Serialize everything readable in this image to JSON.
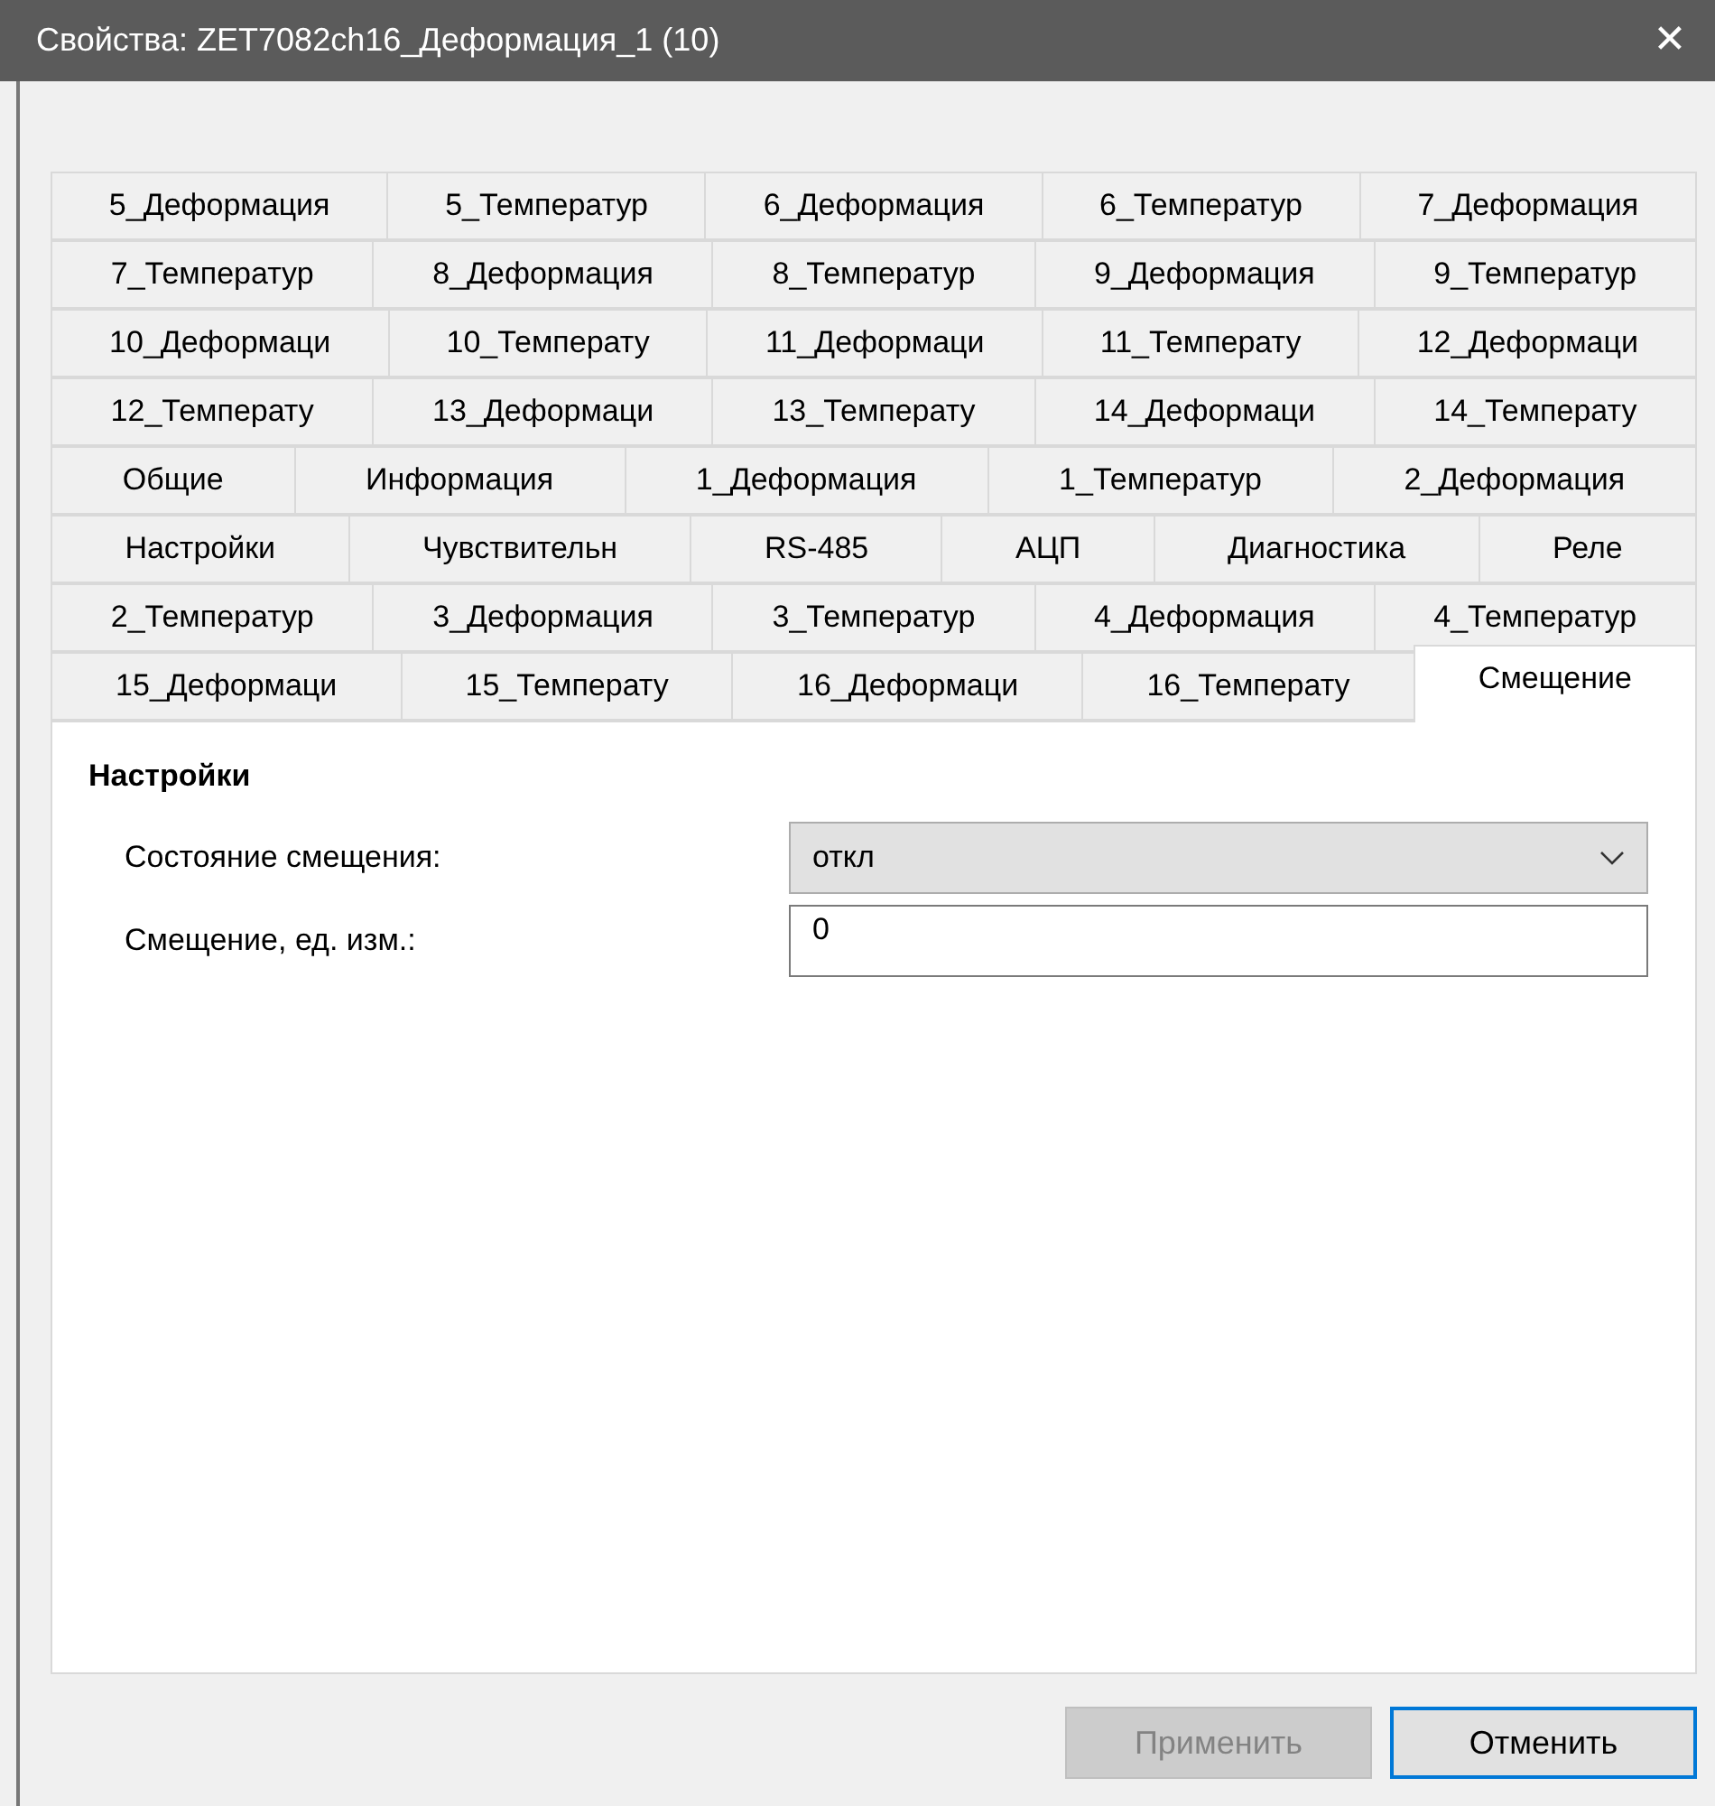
{
  "window": {
    "title": "Свойства: ZET7082ch16_Деформация_1 (10)",
    "close": "✕"
  },
  "tab_rows": [
    [
      {
        "label": "5_Деформация",
        "selected": false
      },
      {
        "label": "5_Температур",
        "selected": false
      },
      {
        "label": "6_Деформация",
        "selected": false
      },
      {
        "label": "6_Температур",
        "selected": false
      },
      {
        "label": "7_Деформация",
        "selected": false
      }
    ],
    [
      {
        "label": "7_Температур",
        "selected": false
      },
      {
        "label": "8_Деформация",
        "selected": false
      },
      {
        "label": "8_Температур",
        "selected": false
      },
      {
        "label": "9_Деформация",
        "selected": false
      },
      {
        "label": "9_Температур",
        "selected": false
      }
    ],
    [
      {
        "label": "10_Деформаци",
        "selected": false
      },
      {
        "label": "10_Температу",
        "selected": false
      },
      {
        "label": "11_Деформаци",
        "selected": false
      },
      {
        "label": "11_Температу",
        "selected": false
      },
      {
        "label": "12_Деформаци",
        "selected": false
      }
    ],
    [
      {
        "label": "12_Температу",
        "selected": false
      },
      {
        "label": "13_Деформаци",
        "selected": false
      },
      {
        "label": "13_Температу",
        "selected": false
      },
      {
        "label": "14_Деформаци",
        "selected": false
      },
      {
        "label": "14_Температу",
        "selected": false
      }
    ],
    [
      {
        "label": "Общие",
        "selected": false
      },
      {
        "label": "Информация",
        "selected": false
      },
      {
        "label": "1_Деформация",
        "selected": false
      },
      {
        "label": "1_Температур",
        "selected": false
      },
      {
        "label": "2_Деформация",
        "selected": false
      }
    ],
    [
      {
        "label": "Настройки",
        "selected": false
      },
      {
        "label": "Чувствительн",
        "selected": false
      },
      {
        "label": "RS-485",
        "selected": false
      },
      {
        "label": "АЦП",
        "selected": false
      },
      {
        "label": "Диагностика",
        "selected": false
      },
      {
        "label": "Реле",
        "selected": false
      }
    ],
    [
      {
        "label": "2_Температур",
        "selected": false
      },
      {
        "label": "3_Деформация",
        "selected": false
      },
      {
        "label": "3_Температур",
        "selected": false
      },
      {
        "label": "4_Деформация",
        "selected": false
      },
      {
        "label": "4_Температур",
        "selected": false
      }
    ],
    [
      {
        "label": "15_Деформаци",
        "selected": false
      },
      {
        "label": "15_Температу",
        "selected": false
      },
      {
        "label": "16_Деформаци",
        "selected": false
      },
      {
        "label": "16_Температу",
        "selected": false
      },
      {
        "label": "Смещение",
        "selected": true
      }
    ]
  ],
  "section": {
    "title": "Настройки"
  },
  "fields": [
    {
      "kind": "dropdown",
      "label": "Состояние смещения:",
      "value": "откл"
    },
    {
      "kind": "text",
      "label": "Смещение, ед. изм.:",
      "value": "0"
    }
  ],
  "buttons": [
    {
      "label": "Применить",
      "disabled": true,
      "focused": false
    },
    {
      "label": "Отменить",
      "disabled": false,
      "focused": true
    }
  ]
}
